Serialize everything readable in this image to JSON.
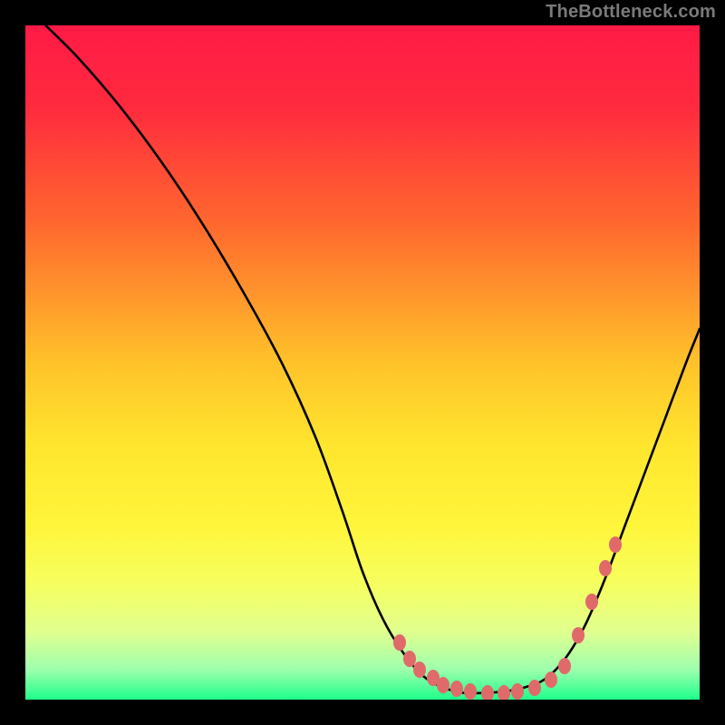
{
  "attribution": "TheBottleneck.com",
  "colors": {
    "background": "#000000",
    "gradient_stops": [
      {
        "pos": 0.0,
        "color": "#ff1a46"
      },
      {
        "pos": 0.12,
        "color": "#ff2a3e"
      },
      {
        "pos": 0.3,
        "color": "#ff6a2e"
      },
      {
        "pos": 0.5,
        "color": "#ffc22a"
      },
      {
        "pos": 0.62,
        "color": "#ffe52e"
      },
      {
        "pos": 0.74,
        "color": "#fff53a"
      },
      {
        "pos": 0.83,
        "color": "#f6ff60"
      },
      {
        "pos": 0.9,
        "color": "#e0ff90"
      },
      {
        "pos": 0.955,
        "color": "#9effad"
      },
      {
        "pos": 1.0,
        "color": "#1eff8a"
      }
    ],
    "curve": "#000000",
    "dot": "#e06a6a"
  },
  "chart_data": {
    "type": "line",
    "title": "",
    "xlabel": "",
    "ylabel": "",
    "xlim": [
      0,
      100
    ],
    "ylim": [
      0,
      100
    ],
    "series": [
      {
        "name": "bottleneck-curve",
        "x": [
          3,
          8,
          14,
          20,
          26,
          32,
          38,
          43,
          47,
          50,
          53,
          56,
          59,
          62,
          65,
          68,
          71,
          74,
          77,
          80,
          83,
          86,
          89,
          92,
          95,
          98,
          100
        ],
        "y": [
          100,
          95,
          88,
          80,
          71,
          61,
          50,
          39,
          28,
          19,
          12,
          7,
          3.5,
          1.8,
          1.0,
          1.0,
          1.2,
          1.8,
          3.0,
          6,
          11,
          18,
          26,
          34,
          42,
          50,
          55
        ]
      }
    ],
    "dots": {
      "name": "highlight-points",
      "x": [
        55.5,
        57,
        58.5,
        60.5,
        62,
        64,
        66,
        68.5,
        71,
        73,
        75.5,
        78,
        80,
        82,
        84,
        86,
        87.5
      ],
      "y": [
        8.5,
        6.0,
        4.5,
        3.2,
        2.2,
        1.6,
        1.2,
        1.0,
        1.0,
        1.2,
        1.8,
        3.0,
        5.0,
        9.5,
        14.5,
        19.5,
        23.0
      ]
    }
  }
}
